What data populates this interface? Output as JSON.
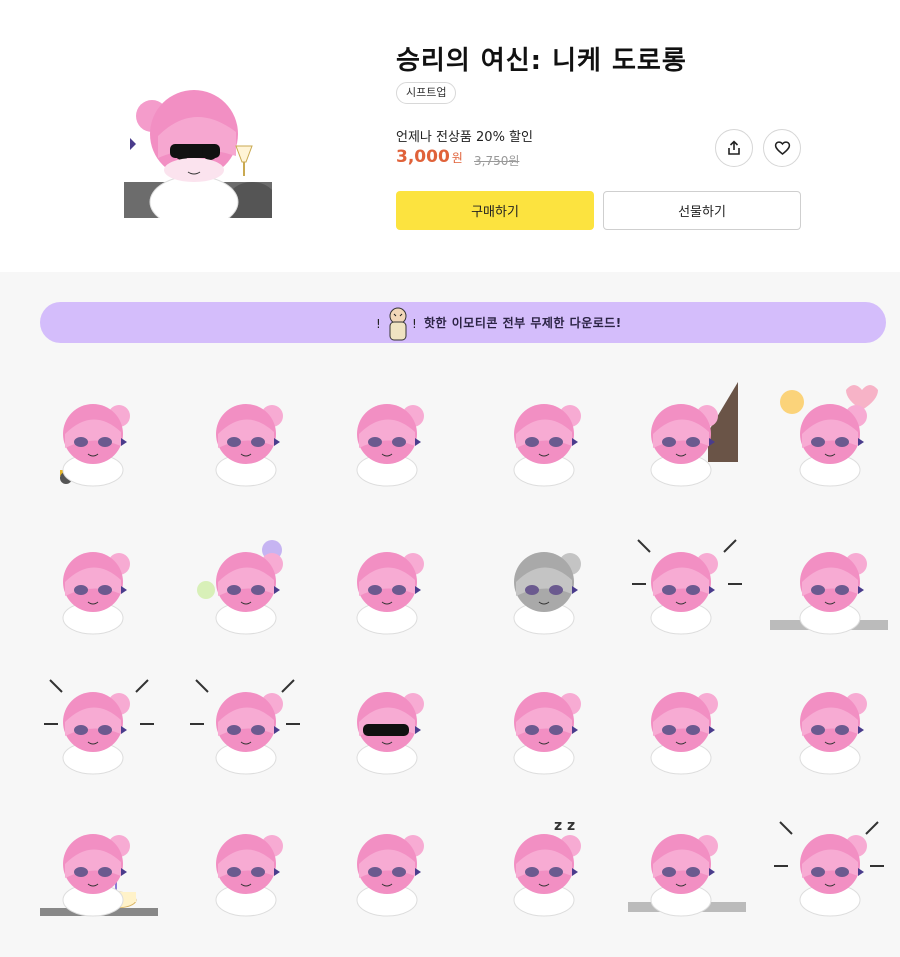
{
  "product": {
    "title": "승리의 여신: 니케 도로롱",
    "author": "시프트업",
    "discount_text": "언제나 전상품 20% 할인",
    "price": "3,000",
    "price_unit": "원",
    "original_price": "3,750원",
    "thumbnail_icon": "sunglasses-wine-sticker"
  },
  "actions": {
    "buy_label": "구매하기",
    "gift_label": "선물하기",
    "share_icon": "share-icon",
    "like_icon": "heart-icon"
  },
  "banner": {
    "text": "핫한 이모티콘 전부 무제한 다운로드!",
    "color": "#d4bdfb"
  },
  "colors": {
    "accent_yellow": "#fce33f",
    "price_red": "#e0623a",
    "hair_pink": "#f28fc3",
    "eye_purple": "#6b5a8f",
    "gallery_bg": "#f7f7f7"
  },
  "stickers": [
    {
      "icon": "scooter-sticker"
    },
    {
      "icon": "waving-sticker"
    },
    {
      "icon": "lying-tiny-sticker"
    },
    {
      "icon": "peek-helmet-sticker"
    },
    {
      "icon": "hiding-wall-sticker"
    },
    {
      "icon": "hearts-sticker"
    },
    {
      "icon": "ghost-sitting-sticker"
    },
    {
      "icon": "happy-bubbles-sticker"
    },
    {
      "icon": "annoyed-sticker"
    },
    {
      "icon": "gray-shocked-sticker"
    },
    {
      "icon": "spark-head-sticker"
    },
    {
      "icon": "table-flip-sticker"
    },
    {
      "icon": "sliding-sticker"
    },
    {
      "icon": "crying-sticker"
    },
    {
      "icon": "sunglasses-sticker"
    },
    {
      "icon": "standing-side-sticker"
    },
    {
      "icon": "blushing-sticker"
    },
    {
      "icon": "lying-down-sticker"
    },
    {
      "icon": "birthday-cake-sticker"
    },
    {
      "icon": "cheering-sticker"
    },
    {
      "icon": "sparkle-peek-sticker"
    },
    {
      "icon": "sleeping-sticker"
    },
    {
      "icon": "table-rest-sticker"
    },
    {
      "icon": "smiling-wave-sticker"
    }
  ]
}
